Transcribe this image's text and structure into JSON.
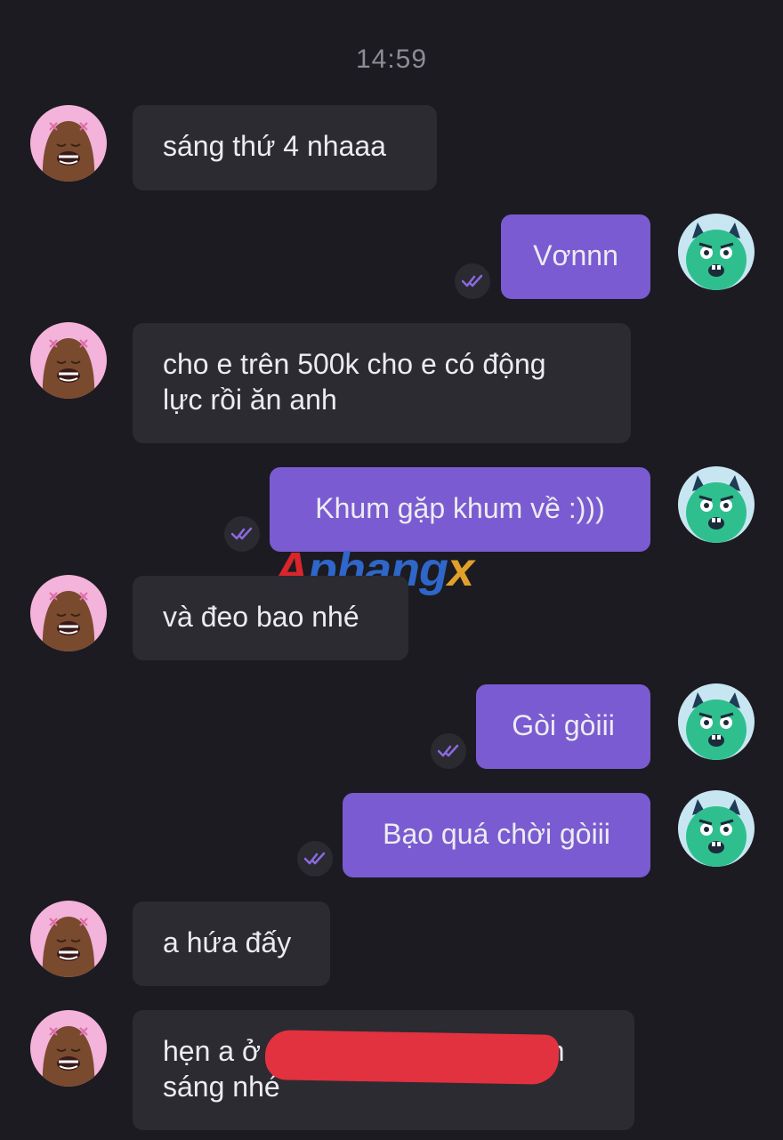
{
  "header": {
    "timestamp": "14:59"
  },
  "watermark": {
    "part_a": "A",
    "part_b": "phang",
    "part_c": "x"
  },
  "messages": [
    {
      "direction": "incoming",
      "text": "sáng thứ 4 nhaaa"
    },
    {
      "direction": "outgoing",
      "text": "Vơnnn",
      "status": "read"
    },
    {
      "direction": "incoming",
      "line1": "cho e trên 500k cho e có động",
      "line2": "lực rồi ăn anh"
    },
    {
      "direction": "outgoing",
      "text": "Khum gặp khum về :)))",
      "status": "read"
    },
    {
      "direction": "incoming",
      "text": "và đeo bao nhé"
    },
    {
      "direction": "outgoing",
      "text": "Gòi gòiii",
      "status": "read"
    },
    {
      "direction": "outgoing",
      "text": "Bạo quá chời gòiii",
      "status": "read"
    },
    {
      "direction": "incoming",
      "text": "a hứa đấy"
    },
    {
      "direction": "incoming",
      "line1_start": "hẹn a ở",
      "line1_end": "8h",
      "line2": "sáng nhé",
      "redacted": true
    }
  ],
  "avatars": {
    "incoming_icon": "pink-blob-avatar",
    "outgoing_icon": "green-monster-avatar"
  },
  "colors": {
    "background": "#1c1b21",
    "incoming_bubble": "#2c2b31",
    "outgoing_bubble": "#7a5bd1",
    "redaction": "#e2313f"
  }
}
